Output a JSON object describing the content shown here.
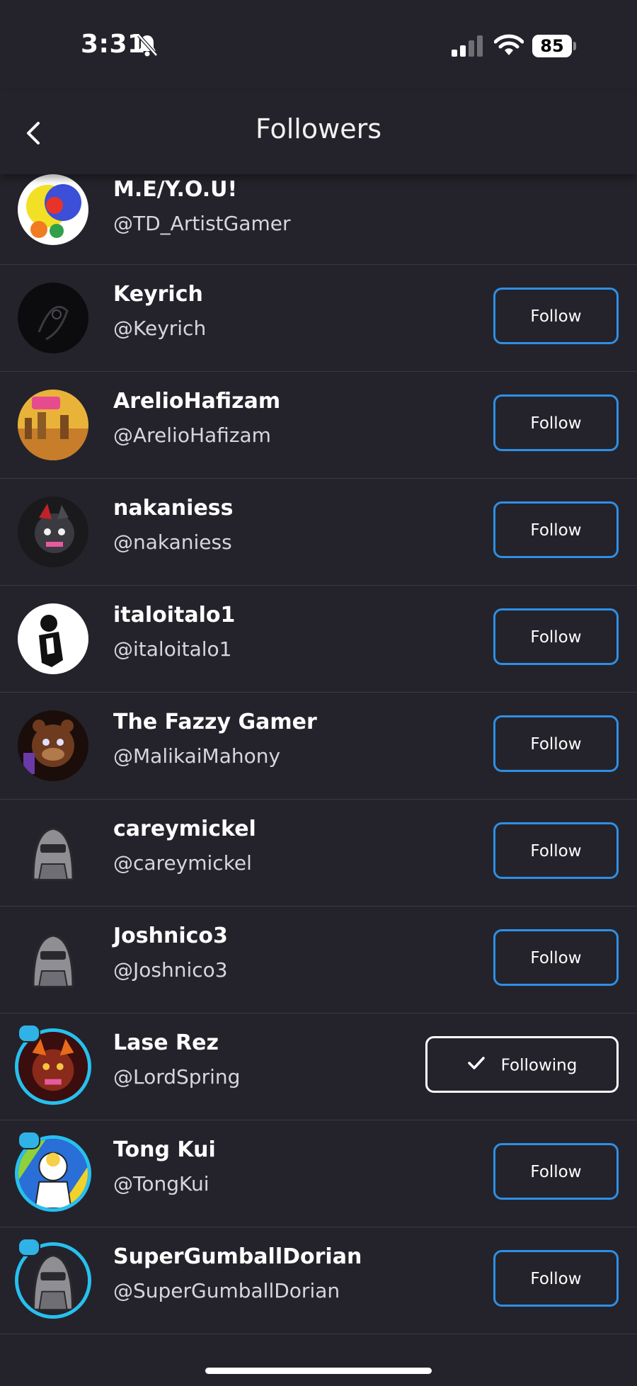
{
  "status": {
    "time": "3:31",
    "battery": "85",
    "silent_icon": "bell-slash-icon",
    "signal_icon": "cellular-signal-icon",
    "wifi_icon": "wifi-icon"
  },
  "header": {
    "title": "Followers",
    "back_icon": "chevron-left-icon"
  },
  "followers": [
    {
      "name": "M.E/Y.O.U!",
      "handle": "@TD_ArtistGamer",
      "button": ""
    },
    {
      "name": "Keyrich",
      "handle": "@Keyrich",
      "button": "Follow"
    },
    {
      "name": "ArelioHafizam",
      "handle": "@ArelioHafizam",
      "button": "Follow"
    },
    {
      "name": "nakaniess",
      "handle": "@nakaniess",
      "button": "Follow"
    },
    {
      "name": "italoitalo1",
      "handle": "@italoitalo1",
      "button": "Follow"
    },
    {
      "name": "The Fazzy Gamer",
      "handle": "@MalikaiMahony",
      "button": "Follow"
    },
    {
      "name": "careymickel",
      "handle": "@careymickel",
      "button": "Follow"
    },
    {
      "name": "Joshnico3",
      "handle": "@Joshnico3",
      "button": "Follow"
    },
    {
      "name": "Lase Rez",
      "handle": "@LordSpring",
      "button": "Following"
    },
    {
      "name": "Tong Kui",
      "handle": "@TongKui",
      "button": "Follow"
    },
    {
      "name": "SuperGumballDorian",
      "handle": "@SuperGumballDorian",
      "button": "Follow"
    }
  ],
  "colors": {
    "background": "#24232b",
    "follow_border": "#2e8fe6",
    "following_border": "#ffffff",
    "ring": "#27c0ef"
  }
}
